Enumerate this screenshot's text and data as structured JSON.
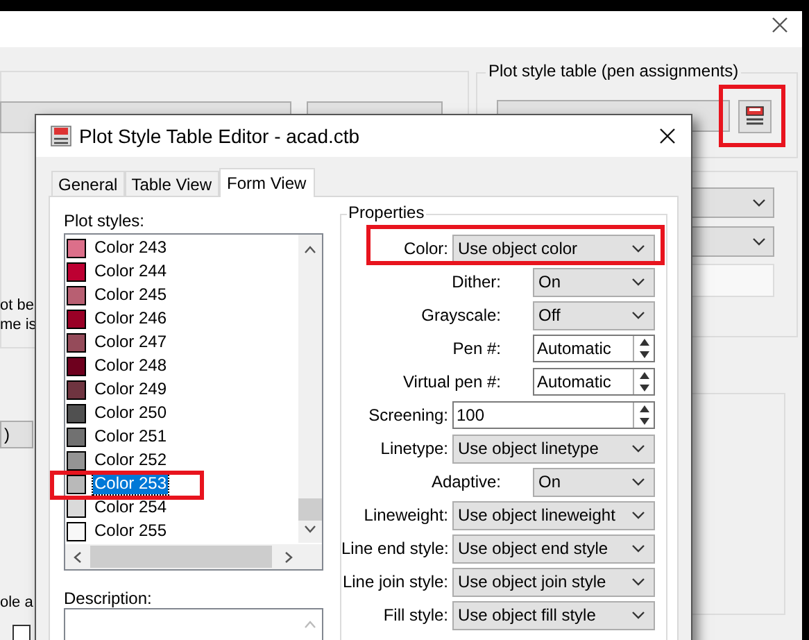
{
  "background_window": {
    "group_label": "Plot style table (pen assignments)",
    "fragments": [
      "ot be",
      "me is",
      ")",
      "ole a"
    ],
    "checkbox": {
      "checked": false
    }
  },
  "dialog": {
    "title": "Plot Style Table Editor - acad.ctb",
    "tabs": [
      {
        "label": "General",
        "selected": false
      },
      {
        "label": "Table View",
        "selected": false
      },
      {
        "label": "Form View",
        "selected": true
      }
    ],
    "plot_styles": {
      "label": "Plot styles:",
      "items": [
        {
          "name": "Color 243",
          "color": "#dc6f8a",
          "selected": false
        },
        {
          "name": "Color 244",
          "color": "#bd0032",
          "selected": false
        },
        {
          "name": "Color 245",
          "color": "#b85f72",
          "selected": false
        },
        {
          "name": "Color 246",
          "color": "#990026",
          "selected": false
        },
        {
          "name": "Color 247",
          "color": "#954b5a",
          "selected": false
        },
        {
          "name": "Color 248",
          "color": "#6e001e",
          "selected": false
        },
        {
          "name": "Color 249",
          "color": "#6f3440",
          "selected": false
        },
        {
          "name": "Color 250",
          "color": "#505050",
          "selected": false
        },
        {
          "name": "Color 251",
          "color": "#717171",
          "selected": false
        },
        {
          "name": "Color 252",
          "color": "#949494",
          "selected": false
        },
        {
          "name": "Color 253",
          "color": "#b9b9b9",
          "selected": true
        },
        {
          "name": "Color 254",
          "color": "#dadada",
          "selected": false
        },
        {
          "name": "Color 255",
          "color": "#f8f8f8",
          "selected": false
        }
      ]
    },
    "description": {
      "label": "Description:"
    },
    "properties": {
      "label": "Properties",
      "rows": [
        {
          "label": "Color:",
          "kind": "select",
          "value": "Use object color",
          "children": [
            {
              "label": "Dither:",
              "kind": "select",
              "value": "On"
            },
            {
              "label": "Grayscale:",
              "kind": "select",
              "value": "Off"
            },
            {
              "label": "Pen #:",
              "kind": "spinner",
              "value": "Automatic"
            },
            {
              "label": "Virtual pen #:",
              "kind": "spinner",
              "value": "Automatic"
            }
          ]
        },
        {
          "label": "Screening:",
          "kind": "spinner",
          "value": "100"
        },
        {
          "label": "Linetype:",
          "kind": "select",
          "value": "Use object linetype",
          "children": [
            {
              "label": "Adaptive:",
              "kind": "select",
              "value": "On"
            }
          ]
        },
        {
          "label": "Lineweight:",
          "kind": "select",
          "value": "Use object lineweight"
        },
        {
          "label": "Line end style:",
          "kind": "select",
          "value": "Use object end style"
        },
        {
          "label": "Line join style:",
          "kind": "select",
          "value": "Use object join style"
        },
        {
          "label": "Fill style:",
          "kind": "select",
          "value": "Use object fill style"
        }
      ]
    }
  }
}
